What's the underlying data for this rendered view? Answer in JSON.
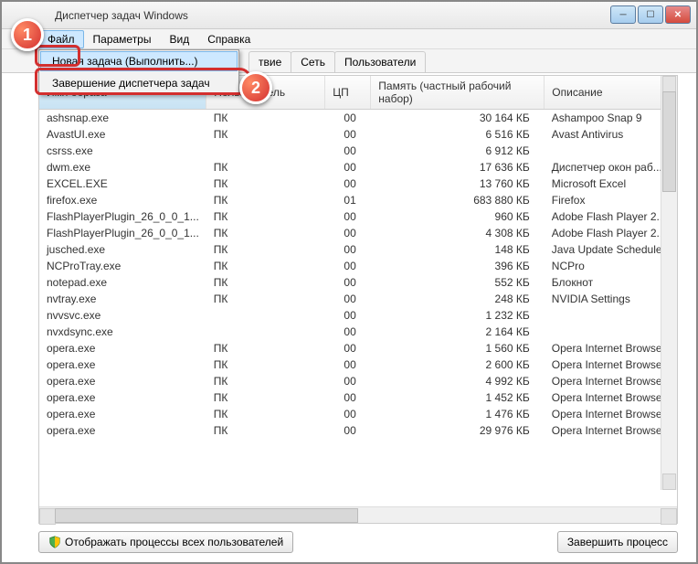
{
  "window": {
    "title": "Диспетчер задач Windows"
  },
  "menu": {
    "items": [
      "Файл",
      "Параметры",
      "Вид",
      "Справка"
    ],
    "dropdown": {
      "new_task": "Новая задача (Выполнить...)",
      "exit": "Завершение диспетчера задач"
    }
  },
  "tabs": {
    "partial1": "твие",
    "net": "Сеть",
    "users": "Пользователи"
  },
  "columns": {
    "image": "Имя образа",
    "user": "Пользователь",
    "cpu": "ЦП",
    "mem": "Память (частный рабочий набор)",
    "desc": "Описание"
  },
  "processes": [
    {
      "img": "ashsnap.exe",
      "user": "ПК",
      "cpu": "00",
      "mem": "30 164 КБ",
      "desc": "Ashampoo Snap 9"
    },
    {
      "img": "AvastUI.exe",
      "user": "ПК",
      "cpu": "00",
      "mem": "6 516 КБ",
      "desc": "Avast Antivirus"
    },
    {
      "img": "csrss.exe",
      "user": "",
      "cpu": "00",
      "mem": "6 912 КБ",
      "desc": ""
    },
    {
      "img": "dwm.exe",
      "user": "ПК",
      "cpu": "00",
      "mem": "17 636 КБ",
      "desc": "Диспетчер окон раб..."
    },
    {
      "img": "EXCEL.EXE",
      "user": "ПК",
      "cpu": "00",
      "mem": "13 760 КБ",
      "desc": "Microsoft Excel"
    },
    {
      "img": "firefox.exe",
      "user": "ПК",
      "cpu": "01",
      "mem": "683 880 КБ",
      "desc": "Firefox"
    },
    {
      "img": "FlashPlayerPlugin_26_0_0_1...",
      "user": "ПК",
      "cpu": "00",
      "mem": "960 КБ",
      "desc": "Adobe Flash Player 2..."
    },
    {
      "img": "FlashPlayerPlugin_26_0_0_1...",
      "user": "ПК",
      "cpu": "00",
      "mem": "4 308 КБ",
      "desc": "Adobe Flash Player 2..."
    },
    {
      "img": "jusched.exe",
      "user": "ПК",
      "cpu": "00",
      "mem": "148 КБ",
      "desc": "Java Update Scheduler"
    },
    {
      "img": "NCProTray.exe",
      "user": "ПК",
      "cpu": "00",
      "mem": "396 КБ",
      "desc": "NCPro"
    },
    {
      "img": "notepad.exe",
      "user": "ПК",
      "cpu": "00",
      "mem": "552 КБ",
      "desc": "Блокнот"
    },
    {
      "img": "nvtray.exe",
      "user": "ПК",
      "cpu": "00",
      "mem": "248 КБ",
      "desc": "NVIDIA Settings"
    },
    {
      "img": "nvvsvc.exe",
      "user": "",
      "cpu": "00",
      "mem": "1 232 КБ",
      "desc": ""
    },
    {
      "img": "nvxdsync.exe",
      "user": "",
      "cpu": "00",
      "mem": "2 164 КБ",
      "desc": ""
    },
    {
      "img": "opera.exe",
      "user": "ПК",
      "cpu": "00",
      "mem": "1 560 КБ",
      "desc": "Opera Internet Browser"
    },
    {
      "img": "opera.exe",
      "user": "ПК",
      "cpu": "00",
      "mem": "2 600 КБ",
      "desc": "Opera Internet Browser"
    },
    {
      "img": "opera.exe",
      "user": "ПК",
      "cpu": "00",
      "mem": "4 992 КБ",
      "desc": "Opera Internet Browser"
    },
    {
      "img": "opera.exe",
      "user": "ПК",
      "cpu": "00",
      "mem": "1 452 КБ",
      "desc": "Opera Internet Browser"
    },
    {
      "img": "opera.exe",
      "user": "ПК",
      "cpu": "00",
      "mem": "1 476 КБ",
      "desc": "Opera Internet Browser"
    },
    {
      "img": "opera.exe",
      "user": "ПК",
      "cpu": "00",
      "mem": "29 976 КБ",
      "desc": "Opera Internet Browser"
    }
  ],
  "buttons": {
    "show_all": "Отображать процессы всех пользователей",
    "end": "Завершить процесс"
  },
  "markers": {
    "m1": "1",
    "m2": "2"
  }
}
